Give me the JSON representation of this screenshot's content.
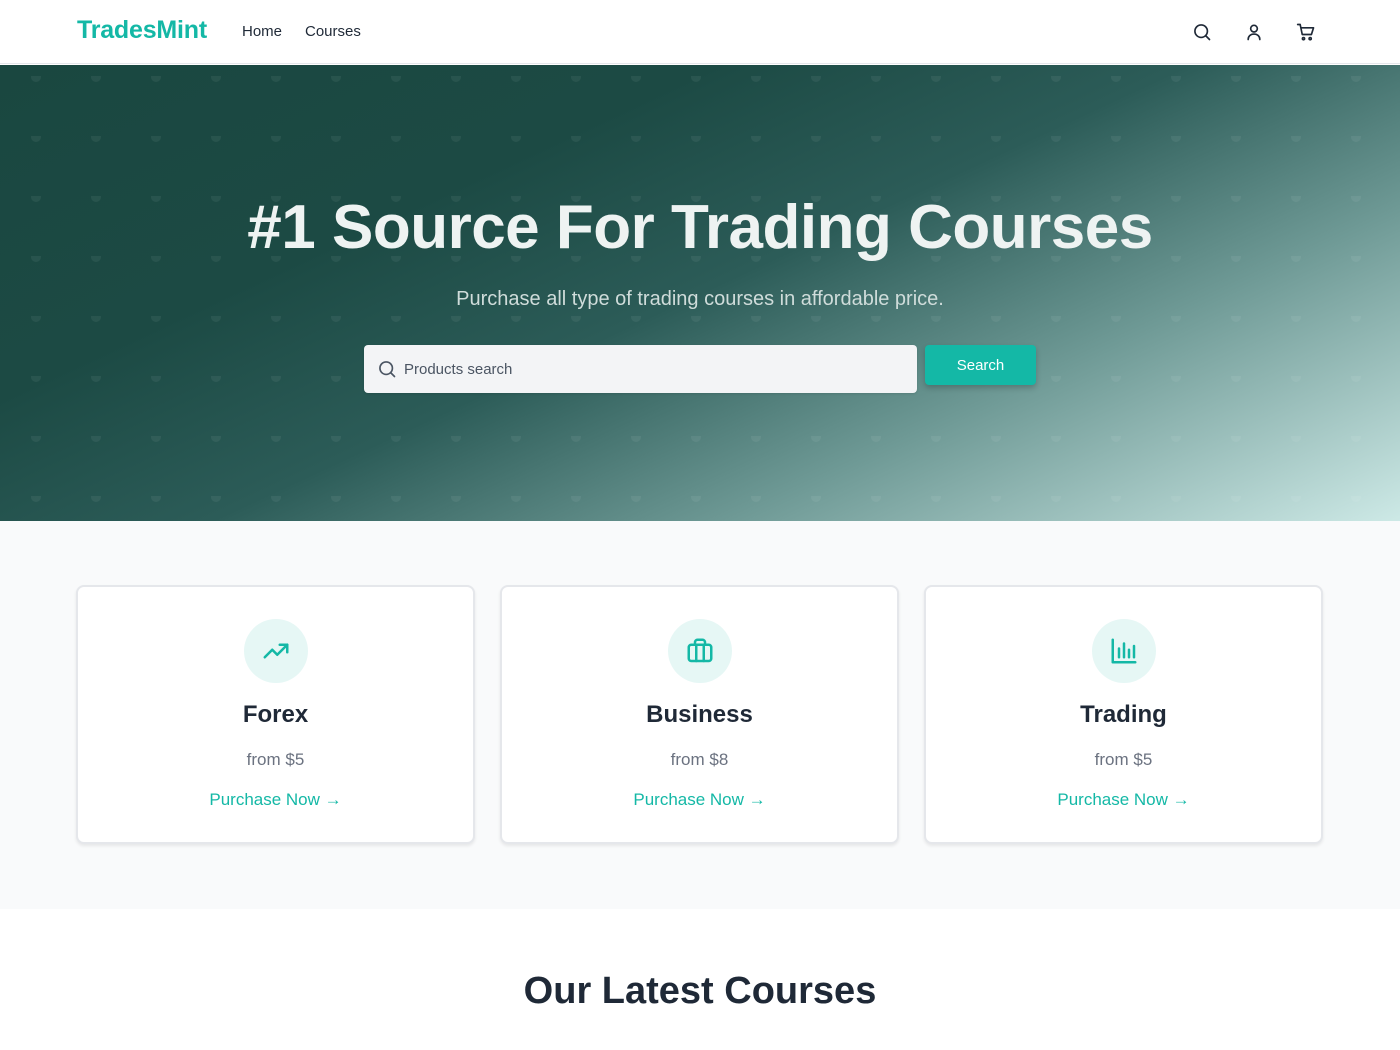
{
  "header": {
    "logo": "TradesMint",
    "nav": [
      "Home",
      "Courses"
    ],
    "icons": [
      "search-icon",
      "user-icon",
      "cart-icon"
    ]
  },
  "hero": {
    "title": "#1 Source For Trading Courses",
    "subtitle": "Purchase all type of trading courses in affordable price.",
    "search": {
      "placeholder": "Products search",
      "value": "",
      "button_label": "Search"
    }
  },
  "categories": [
    {
      "title": "Forex",
      "price": "from $5",
      "link": "Purchase Now →",
      "icon": "trending-up-icon"
    },
    {
      "title": "Business",
      "price": "from $8",
      "link": "Purchase Now →",
      "icon": "briefcase-icon"
    },
    {
      "title": "Trading",
      "price": "from $5",
      "link": "Purchase Now →",
      "icon": "bar-chart-icon"
    }
  ],
  "latest": {
    "title": "Our Latest Courses"
  },
  "colors": {
    "accent": "#14b8a6",
    "hero_dark": "#1a4740",
    "hero_light": "#cde9e6",
    "text": "#1f2937",
    "muted": "#6b7280"
  }
}
